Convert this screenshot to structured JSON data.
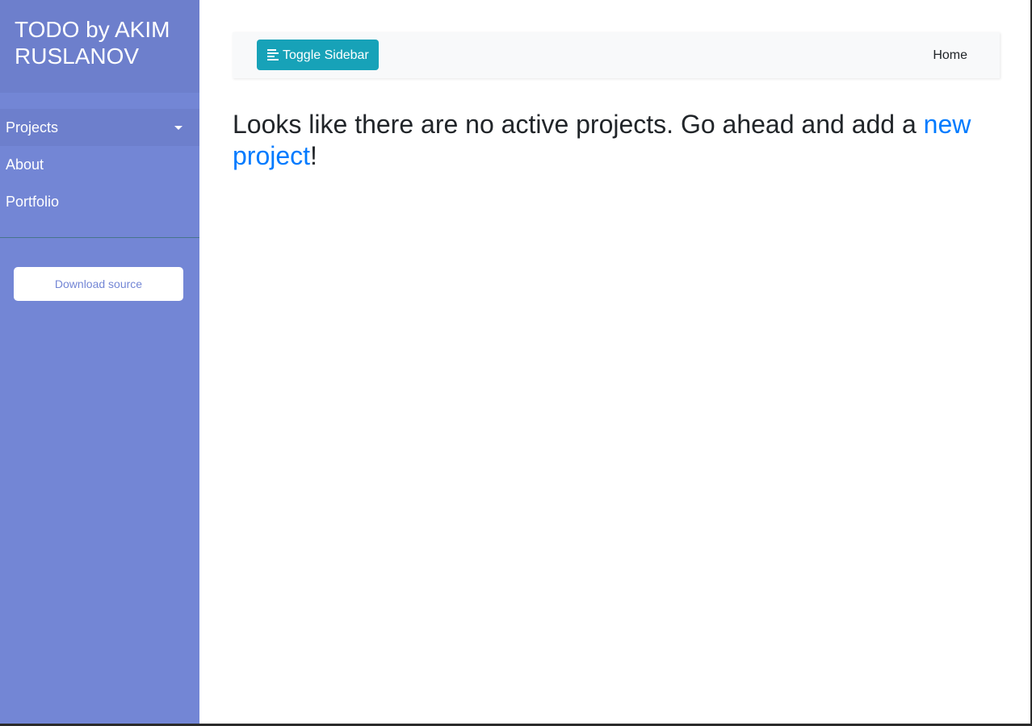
{
  "sidebar": {
    "title": "TODO by AKIM RUSLANOV",
    "items": [
      {
        "label": "Projects",
        "icon": "caret-down-icon"
      },
      {
        "label": "About"
      },
      {
        "label": "Portfolio"
      }
    ],
    "download_label": "Download source"
  },
  "navbar": {
    "toggle_label": "Toggle Sidebar",
    "toggle_icon": "align-left-icon",
    "home_label": "Home"
  },
  "main": {
    "message_prefix": "Looks like there are no active projects. Go ahead and add a ",
    "message_link": "new project",
    "message_suffix": "!"
  },
  "colors": {
    "sidebar_bg": "#7386d5",
    "sidebar_header_bg": "#6d7fcc",
    "toggle_button_bg": "#17a2b8",
    "link": "#007bff"
  }
}
